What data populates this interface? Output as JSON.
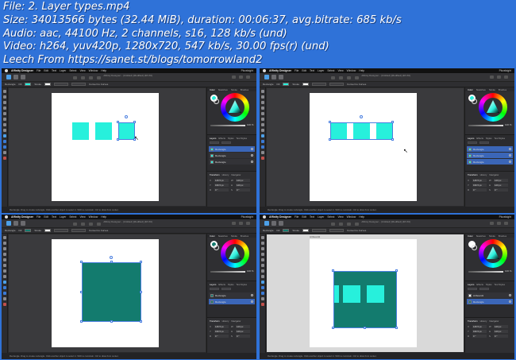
{
  "info": {
    "file": "File: 2. Layer types.mp4",
    "size": "Size: 34013566 bytes (32.44 MiB), duration: 00:06:37, avg.bitrate: 685 kb/s",
    "audio": "Audio: aac, 44100 Hz, 2 channels, s16, 128 kb/s (und)",
    "video": "Video: h264, yuv420p, 1280x720, 547 kb/s, 30.00 fps(r) (und)",
    "leech": "Leech From https://sanet.st/blogs/tomorrowland2"
  },
  "app": {
    "name": "Affinity Designer",
    "menus": [
      "File",
      "Edit",
      "Text",
      "Layer",
      "Select",
      "View",
      "Window",
      "Help"
    ],
    "menu_right": "Pluralsight",
    "doc_title": "Affinity Designer - (Untitled) [Modified] (48.4%)",
    "context_label": "Rectangle",
    "context_fill": "Fill",
    "context_stroke": "Stroke",
    "context_extra": "Convert to Curves",
    "panel_tabs": [
      "Color",
      "Swatches",
      "Stroke",
      "Brushes"
    ],
    "opacity_label": "100 %",
    "layer_tabs": [
      "Layers",
      "Effects",
      "Styles",
      "Text Styles"
    ],
    "transform_tabs": [
      "Transform",
      "History",
      "Navigator"
    ],
    "transform": {
      "x": "146.5 px",
      "y": "196.5 px",
      "w": "120 px",
      "h": "120 px",
      "r": "0 °",
      "s": "0 °"
    },
    "status": "Rectangle. Drag to create rectangle. Click another object to select it. Shift to constrain. Ctrl to draw from center.",
    "artboard_label": "Artboard1"
  },
  "panes": [
    {
      "layers": [
        {
          "name": "Rectangle",
          "selected": true
        },
        {
          "name": "Rectangle",
          "selected": false
        },
        {
          "name": "Rectangle",
          "selected": false
        }
      ]
    },
    {
      "layers": [
        {
          "name": "Rectangle",
          "selected": true
        },
        {
          "name": "Rectangle",
          "selected": true
        },
        {
          "name": "Rectangle",
          "selected": true
        }
      ]
    },
    {
      "layers": [
        {
          "name": "Rectangle",
          "selected": false
        },
        {
          "name": "Rectangle",
          "selected": true
        }
      ]
    },
    {
      "layers": [
        {
          "name": "Artboard1",
          "selected": false
        },
        {
          "name": "Rectangle",
          "selected": true
        }
      ]
    }
  ],
  "colors": {
    "cyan": "#27f0dc",
    "teal": "#137b6e",
    "selection": "#4a7fe0",
    "background": "#2f72d8"
  }
}
